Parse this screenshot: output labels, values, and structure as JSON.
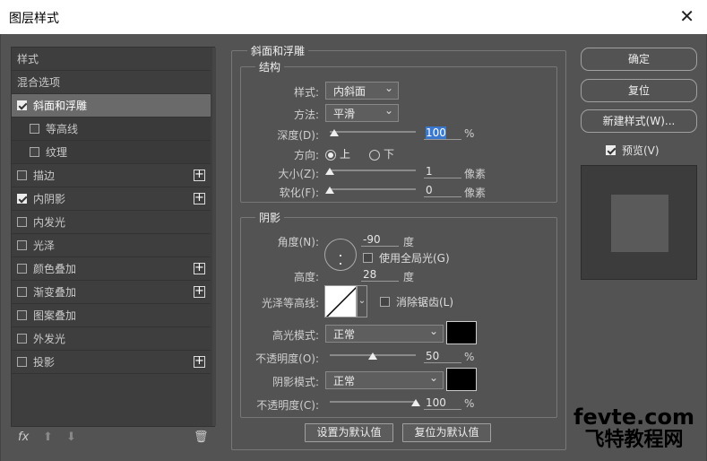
{
  "window": {
    "title": "图层样式",
    "close": "✕"
  },
  "styles": [
    {
      "label": "样式",
      "check": false,
      "hasbox": false,
      "plus": false,
      "sel": false,
      "sub": false
    },
    {
      "label": "混合选项",
      "check": false,
      "hasbox": false,
      "plus": false,
      "sel": false,
      "sub": false
    },
    {
      "label": "斜面和浮雕",
      "check": true,
      "hasbox": true,
      "plus": false,
      "sel": true,
      "sub": false
    },
    {
      "label": "等高线",
      "check": false,
      "hasbox": true,
      "plus": false,
      "sel": false,
      "sub": true
    },
    {
      "label": "纹理",
      "check": false,
      "hasbox": true,
      "plus": false,
      "sel": false,
      "sub": true
    },
    {
      "label": "描边",
      "check": false,
      "hasbox": true,
      "plus": true,
      "sel": false,
      "sub": false
    },
    {
      "label": "内阴影",
      "check": true,
      "hasbox": true,
      "plus": true,
      "sel": false,
      "sub": false
    },
    {
      "label": "内发光",
      "check": false,
      "hasbox": true,
      "plus": false,
      "sel": false,
      "sub": false
    },
    {
      "label": "光泽",
      "check": false,
      "hasbox": true,
      "plus": false,
      "sel": false,
      "sub": false
    },
    {
      "label": "颜色叠加",
      "check": false,
      "hasbox": true,
      "plus": true,
      "sel": false,
      "sub": false
    },
    {
      "label": "渐变叠加",
      "check": false,
      "hasbox": true,
      "plus": true,
      "sel": false,
      "sub": false
    },
    {
      "label": "图案叠加",
      "check": false,
      "hasbox": true,
      "plus": false,
      "sel": false,
      "sub": false
    },
    {
      "label": "外发光",
      "check": false,
      "hasbox": true,
      "plus": false,
      "sel": false,
      "sub": false
    },
    {
      "label": "投影",
      "check": false,
      "hasbox": true,
      "plus": true,
      "sel": false,
      "sub": false
    }
  ],
  "bottom": {
    "fx": "fx",
    "up": "⬆",
    "down": "⬇",
    "trash": "🗑"
  },
  "bevel": {
    "title": "斜面和浮雕",
    "structure": "结构",
    "style_label": "样式:",
    "style_value": "内斜面",
    "technique_label": "方法:",
    "technique_value": "平滑",
    "depth_label": "深度(D):",
    "depth_value": "100",
    "depth_unit": "%",
    "depth_pct": 5,
    "direction_label": "方向:",
    "dir_up": "上",
    "dir_down": "下",
    "size_label": "大小(Z):",
    "size_value": "1",
    "size_unit": "像素",
    "size_pct": 0,
    "soften_label": "软化(F):",
    "soften_value": "0",
    "soften_unit": "像素",
    "soften_pct": 0
  },
  "shading": {
    "title": "阴影",
    "angle_label": "角度(N):",
    "angle_value": "-90",
    "angle_unit": "度",
    "global_light": "使用全局光(G)",
    "altitude_label": "高度:",
    "altitude_value": "28",
    "altitude_unit": "度",
    "gloss_label": "光泽等高线:",
    "antialias": "消除锯齿(L)",
    "hl_mode_label": "高光模式:",
    "hl_mode": "正常",
    "hl_opacity_label": "不透明度(O):",
    "hl_opacity": "50",
    "hl_pct": 50,
    "sh_mode_label": "阴影模式:",
    "sh_mode": "正常",
    "sh_opacity_label": "不透明度(C):",
    "sh_opacity": "100",
    "sh_pct": 100,
    "pct": "%",
    "hl_color": "#000000",
    "sh_color": "#000000"
  },
  "defaults": {
    "make": "设置为默认值",
    "reset": "复位为默认值"
  },
  "buttons": {
    "ok": "确定",
    "reset": "复位",
    "new_style": "新建样式(W)...",
    "preview": "预览(V)"
  },
  "watermark": {
    "line1": "fevte.com",
    "line2": "飞特教程网"
  }
}
